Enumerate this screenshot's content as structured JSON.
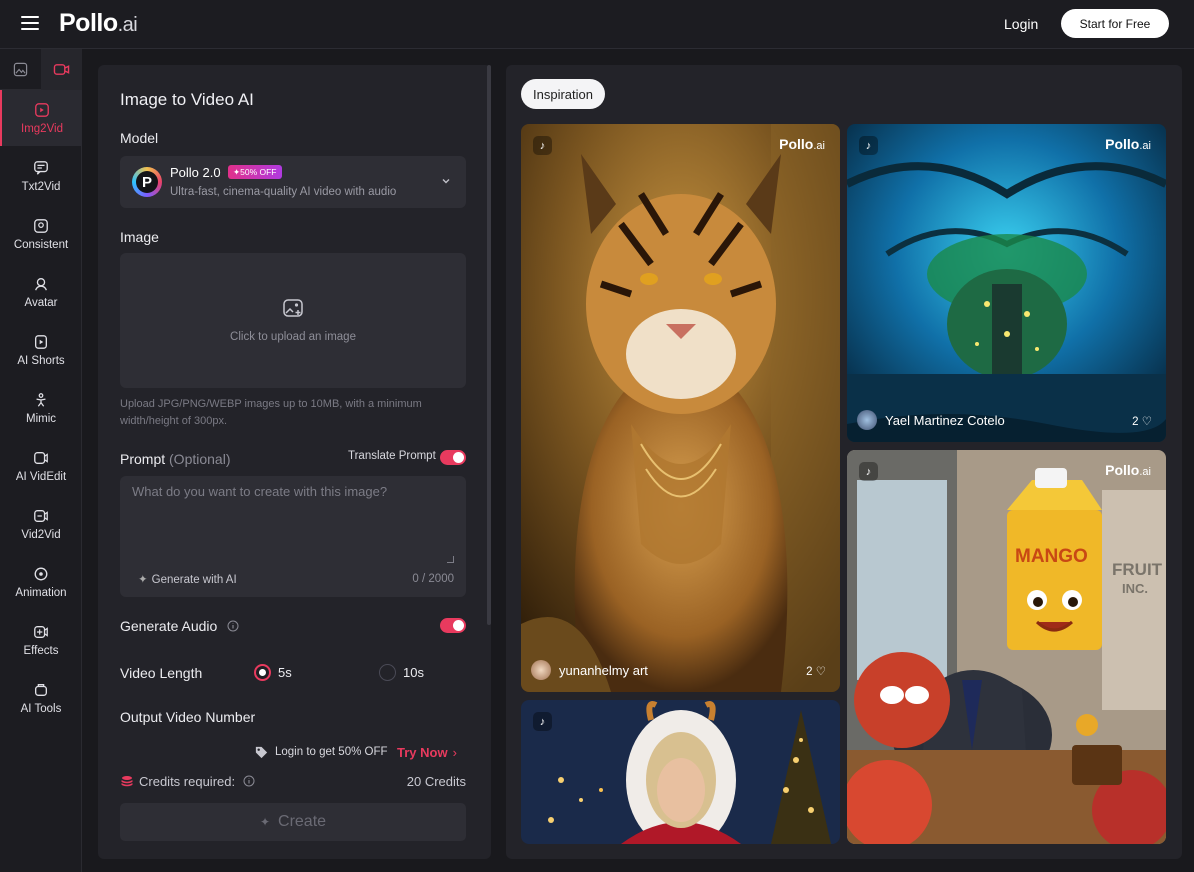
{
  "header": {
    "logo": "Pollo",
    "logo_suffix": ".ai",
    "login": "Login",
    "start": "Start for Free"
  },
  "sidebar": {
    "items": [
      {
        "label": "Img2Vid",
        "icon": "image-to-video-icon",
        "active": true
      },
      {
        "label": "Txt2Vid",
        "icon": "text-to-video-icon"
      },
      {
        "label": "Consistent",
        "icon": "consistent-icon"
      },
      {
        "label": "Avatar",
        "icon": "avatar-icon"
      },
      {
        "label": "AI Shorts",
        "icon": "shorts-icon"
      },
      {
        "label": "Mimic",
        "icon": "mimic-icon"
      },
      {
        "label": "AI VidEdit",
        "icon": "video-edit-icon"
      },
      {
        "label": "Vid2Vid",
        "icon": "video-to-video-icon"
      },
      {
        "label": "Animation",
        "icon": "animation-icon"
      },
      {
        "label": "Effects",
        "icon": "effects-icon"
      },
      {
        "label": "AI Tools",
        "icon": "tools-icon"
      }
    ]
  },
  "form": {
    "title": "Image to Video AI",
    "model_label": "Model",
    "model": {
      "name": "Pollo 2.0",
      "badge": "✦50% OFF",
      "desc": "Ultra-fast, cinema-quality AI video with audio"
    },
    "image_label": "Image",
    "upload_text": "Click to upload an image",
    "upload_hint": "Upload JPG/PNG/WEBP images up to 10MB, with a minimum width/height of 300px.",
    "prompt_label": "Prompt",
    "prompt_optional": "(Optional)",
    "translate_label": "Translate Prompt",
    "translate_on": true,
    "prompt_placeholder": "What do you want to create with this image?",
    "generate_ai": "Generate with AI",
    "char_count": "0 / 2000",
    "audio_label": "Generate Audio",
    "audio_on": true,
    "length_label": "Video Length",
    "length_options": [
      "5s",
      "10s"
    ],
    "length_selected": "5s",
    "output_label": "Output Video Number",
    "promo_text": "Login to get 50% OFF",
    "try_now": "Try Now",
    "credits_label": "Credits required:",
    "credits_value": "20 Credits",
    "create": "Create"
  },
  "gallery": {
    "tab": "Inspiration",
    "brand": "Pollo",
    "brand_suffix": ".ai",
    "cards": [
      {
        "user": "yunanhelmy art",
        "likes": "2"
      },
      {
        "user": "Yael Martinez Cotelo",
        "likes": "2"
      },
      {
        "user": "",
        "likes": ""
      },
      {
        "user": "",
        "likes": ""
      }
    ],
    "card3_text": [
      "MANGO",
      "FRUIT",
      "INC."
    ]
  },
  "colors": {
    "accent": "#e83a5e",
    "bg": "#19191d",
    "panel": "#232329",
    "field": "#2e2e35"
  }
}
